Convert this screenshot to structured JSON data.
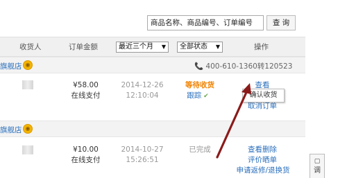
{
  "search": {
    "placeholder": "商品名称、商品编号、订单编号",
    "button_label": "查 询"
  },
  "table_header": {
    "receiver": "收货人",
    "amount": "订单金额",
    "time_filter": "最近三个月",
    "status_filter": "全部状态",
    "actions": "操作"
  },
  "orders": [
    {
      "shop": "旗舰店",
      "hotline": "400-610-1360转120523",
      "price": "¥58.00",
      "payment": "在线支付",
      "date": "2014-12-26",
      "time": "12:10:04",
      "status": "等待收货",
      "track": "跟踪",
      "actions": [
        "查看",
        "确认收货",
        "取消订单"
      ]
    },
    {
      "shop": "旗舰店",
      "price": "¥10.00",
      "payment": "在线支付",
      "date": "2014-10-27",
      "time": "15:26:51",
      "status": "已完成",
      "actions": [
        "查看删除",
        "评价晒单",
        "申请返修/退换货"
      ]
    }
  ],
  "tooltip": "确认收货",
  "feedback_tab": "调",
  "colors": {
    "link": "#2a6fbc",
    "status_waiting": "#f08200",
    "annotation_arrow": "#8b1a1a"
  }
}
